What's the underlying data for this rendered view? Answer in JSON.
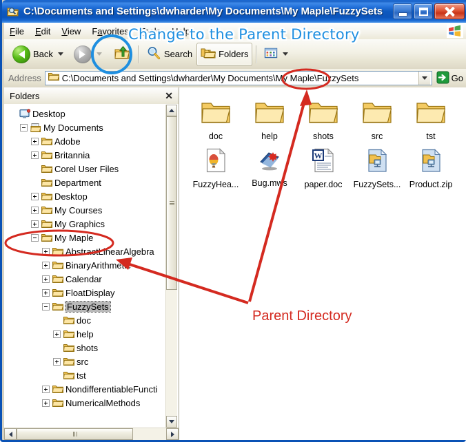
{
  "window": {
    "title": "C:\\Documents and Settings\\dwharder\\My Documents\\My Maple\\FuzzySets",
    "icon": "folder-search-icon",
    "minimize_label": "Minimize",
    "maximize_label": "Maximize",
    "close_label": "Close"
  },
  "menubar": {
    "items": [
      {
        "label": "File",
        "accel": "F"
      },
      {
        "label": "Edit",
        "accel": "E"
      },
      {
        "label": "View",
        "accel": "V"
      },
      {
        "label": "Favorites",
        "accel": "a"
      },
      {
        "label": "Tools",
        "accel": "T"
      },
      {
        "label": "Help",
        "accel": "H"
      }
    ],
    "brand_icon": "windows-flag-icon"
  },
  "toolbar": {
    "back_label": "Back",
    "back_icon": "back-arrow-icon",
    "back_dropdown_icon": "chevron-down-icon",
    "forward_icon": "forward-arrow-icon",
    "forward_dropdown_icon": "chevron-down-icon",
    "up_label": "Up",
    "up_icon": "up-one-level-icon",
    "search_label": "Search",
    "search_icon": "magnifier-icon",
    "folders_label": "Folders",
    "folders_icon": "folders-icon",
    "views_icon": "views-icon",
    "views_dropdown_icon": "chevron-down-icon"
  },
  "address": {
    "label": "Address",
    "icon": "folder-icon",
    "value": "C:\\Documents and Settings\\dwharder\\My Documents\\My Maple\\FuzzySets",
    "dropdown_icon": "chevron-down-icon",
    "go_label": "Go",
    "go_icon": "go-arrow-icon"
  },
  "tree": {
    "header": "Folders",
    "close_icon": "close-x-icon",
    "items": [
      {
        "label": "Desktop",
        "indent": 0,
        "expander": "none",
        "icon": "desktop-icon",
        "selected": false
      },
      {
        "label": "My Documents",
        "indent": 1,
        "expander": "minus",
        "icon": "my-documents-icon",
        "selected": false
      },
      {
        "label": "Adobe",
        "indent": 2,
        "expander": "plus",
        "icon": "folder-icon",
        "selected": false
      },
      {
        "label": "Britannia",
        "indent": 2,
        "expander": "plus",
        "icon": "folder-icon",
        "selected": false
      },
      {
        "label": "Corel User Files",
        "indent": 2,
        "expander": "none",
        "icon": "folder-icon",
        "selected": false
      },
      {
        "label": "Department",
        "indent": 2,
        "expander": "none",
        "icon": "folder-icon",
        "selected": false
      },
      {
        "label": "Desktop",
        "indent": 2,
        "expander": "plus",
        "icon": "folder-icon",
        "selected": false
      },
      {
        "label": "My Courses",
        "indent": 2,
        "expander": "plus",
        "icon": "folder-icon",
        "selected": false
      },
      {
        "label": "My Graphics",
        "indent": 2,
        "expander": "plus",
        "icon": "folder-icon",
        "selected": false
      },
      {
        "label": "My Maple",
        "indent": 2,
        "expander": "minus",
        "icon": "folder-icon",
        "selected": false
      },
      {
        "label": "AbstractLinearAlgebra",
        "indent": 3,
        "expander": "plus",
        "icon": "folder-icon",
        "selected": false
      },
      {
        "label": "BinaryArithmetic",
        "indent": 3,
        "expander": "plus",
        "icon": "folder-icon",
        "selected": false
      },
      {
        "label": "Calendar",
        "indent": 3,
        "expander": "plus",
        "icon": "folder-icon",
        "selected": false
      },
      {
        "label": "FloatDisplay",
        "indent": 3,
        "expander": "plus",
        "icon": "folder-icon",
        "selected": false
      },
      {
        "label": "FuzzySets",
        "indent": 3,
        "expander": "minus",
        "icon": "folder-icon",
        "selected": true
      },
      {
        "label": "doc",
        "indent": 4,
        "expander": "none",
        "icon": "folder-icon",
        "selected": false
      },
      {
        "label": "help",
        "indent": 4,
        "expander": "plus",
        "icon": "folder-icon",
        "selected": false
      },
      {
        "label": "shots",
        "indent": 4,
        "expander": "none",
        "icon": "folder-icon",
        "selected": false
      },
      {
        "label": "src",
        "indent": 4,
        "expander": "plus",
        "icon": "folder-icon",
        "selected": false
      },
      {
        "label": "tst",
        "indent": 4,
        "expander": "none",
        "icon": "folder-icon",
        "selected": false
      },
      {
        "label": "NondifferentiableFuncti",
        "indent": 3,
        "expander": "plus",
        "icon": "folder-icon",
        "selected": false
      },
      {
        "label": "NumericalMethods",
        "indent": 3,
        "expander": "plus",
        "icon": "folder-icon",
        "selected": false
      }
    ],
    "scroll_up_icon": "scroll-up-icon",
    "scroll_down_icon": "scroll-down-icon",
    "scroll_left_icon": "scroll-left-icon",
    "scroll_right_icon": "scroll-right-icon"
  },
  "files": {
    "items": [
      {
        "label": "doc",
        "icon": "folder-icon"
      },
      {
        "label": "help",
        "icon": "folder-icon"
      },
      {
        "label": "shots",
        "icon": "folder-icon"
      },
      {
        "label": "src",
        "icon": "folder-icon"
      },
      {
        "label": "tst",
        "icon": "folder-icon"
      },
      {
        "label": "FuzzyHea...",
        "icon": "image-file-icon"
      },
      {
        "label": "Bug.mws",
        "icon": "maple-worksheet-icon"
      },
      {
        "label": "paper.doc",
        "icon": "word-document-icon"
      },
      {
        "label": "FuzzySets...",
        "icon": "zip-archive-icon"
      },
      {
        "label": "Product.zip",
        "icon": "zip-archive-icon"
      }
    ]
  },
  "annotations": {
    "blue_callout": "Change to the Parent Directory",
    "red_callout": "Parent Directory",
    "blue_color": "#1f8fe0",
    "red_color": "#d42a20"
  }
}
